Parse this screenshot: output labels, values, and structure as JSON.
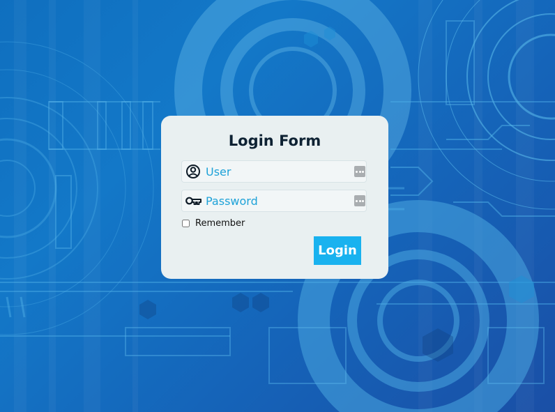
{
  "login_form": {
    "title": "Login Form",
    "user_field": {
      "placeholder": "User",
      "value": "",
      "icon": "user-circle-icon"
    },
    "password_field": {
      "placeholder": "Password",
      "value": "",
      "icon": "key-icon"
    },
    "remember_label": "Remember",
    "remember_checked": false,
    "login_button_label": "Login"
  },
  "colors": {
    "accent": "#19b2ef",
    "field_text": "#1ea2d8",
    "card_background": "#e9f0f1",
    "page_background": "#1570c0"
  }
}
